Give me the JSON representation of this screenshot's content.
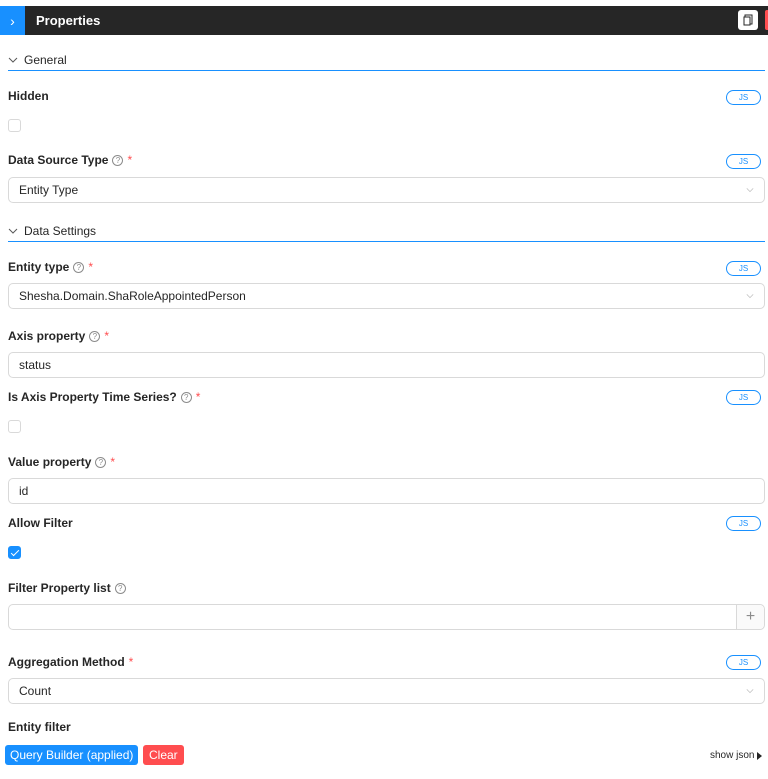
{
  "header": {
    "title": "Properties",
    "toggle_icon": "chevron-right-icon",
    "copy_icon": "copy-icon"
  },
  "sections": {
    "general": {
      "label": "General",
      "expanded": true
    },
    "data_settings": {
      "label": "Data Settings",
      "expanded": true
    }
  },
  "fields": {
    "hidden": {
      "label": "Hidden",
      "checked": false,
      "js_label": "JS"
    },
    "data_source_type": {
      "label": "Data Source Type",
      "help": "?",
      "required": "*",
      "value": "Entity Type",
      "js_label": "JS"
    },
    "entity_type": {
      "label": "Entity type",
      "help": "?",
      "required": "*",
      "value": "Shesha.Domain.ShaRoleAppointedPerson",
      "js_label": "JS"
    },
    "axis_property": {
      "label": "Axis property",
      "help": "?",
      "required": "*",
      "value": "status"
    },
    "is_axis_time_series": {
      "label": "Is Axis Property Time Series?",
      "help": "?",
      "required": "*",
      "checked": false,
      "js_label": "JS"
    },
    "value_property": {
      "label": "Value property",
      "help": "?",
      "required": "*",
      "value": "id"
    },
    "allow_filter": {
      "label": "Allow Filter",
      "checked": true,
      "js_label": "JS"
    },
    "filter_property_list": {
      "label": "Filter Property list",
      "help": "?",
      "value": "",
      "add_label": "+"
    },
    "aggregation_method": {
      "label": "Aggregation Method",
      "required": "*",
      "value": "Count",
      "js_label": "JS"
    },
    "entity_filter": {
      "label": "Entity filter"
    }
  },
  "actions": {
    "query_builder": "Query Builder (applied)",
    "clear": "Clear",
    "show_json": "show json"
  },
  "colors": {
    "primary": "#1890ff",
    "danger": "#ff4d4f",
    "header_bg": "#262626"
  }
}
